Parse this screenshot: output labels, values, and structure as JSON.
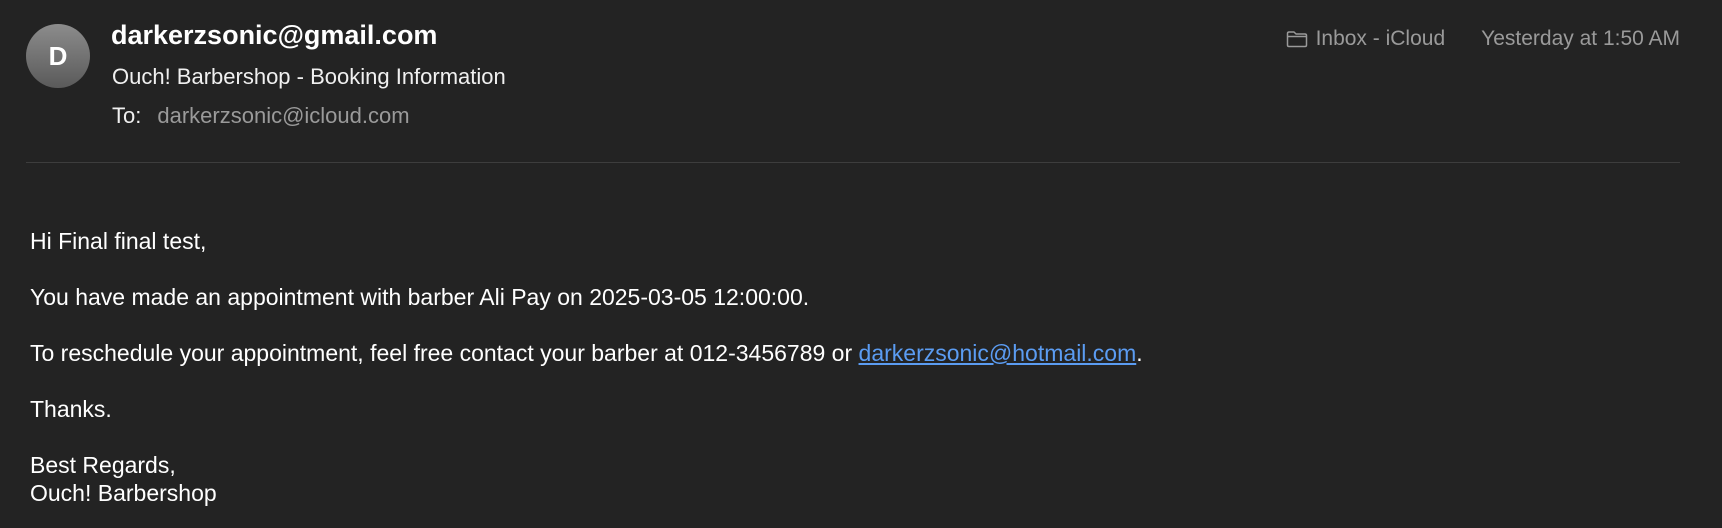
{
  "header": {
    "avatar_initial": "D",
    "sender": "darkerzsonic@gmail.com",
    "subject": "Ouch! Barbershop - Booking Information",
    "to_label": "To:",
    "to_value": "darkerzsonic@icloud.com",
    "mailbox_icon": "folder-icon",
    "mailbox": "Inbox - iCloud",
    "date": "Yesterday at 1:50 AM"
  },
  "body": {
    "greeting": "Hi Final final test,",
    "appointment": "You have made an appointment with barber Ali Pay on 2025-03-05 12:00:00.",
    "reschedule_prefix": "To reschedule your appointment, feel free contact your barber at 012-3456789 or ",
    "reschedule_link": "darkerzsonic@hotmail.com",
    "reschedule_suffix": ".",
    "thanks": "Thanks.",
    "regards": "Best Regards,",
    "signature": "Ouch! Barbershop"
  },
  "colors": {
    "background": "#232323",
    "link": "#5b9cf2",
    "muted_text": "#9a9a9a"
  }
}
